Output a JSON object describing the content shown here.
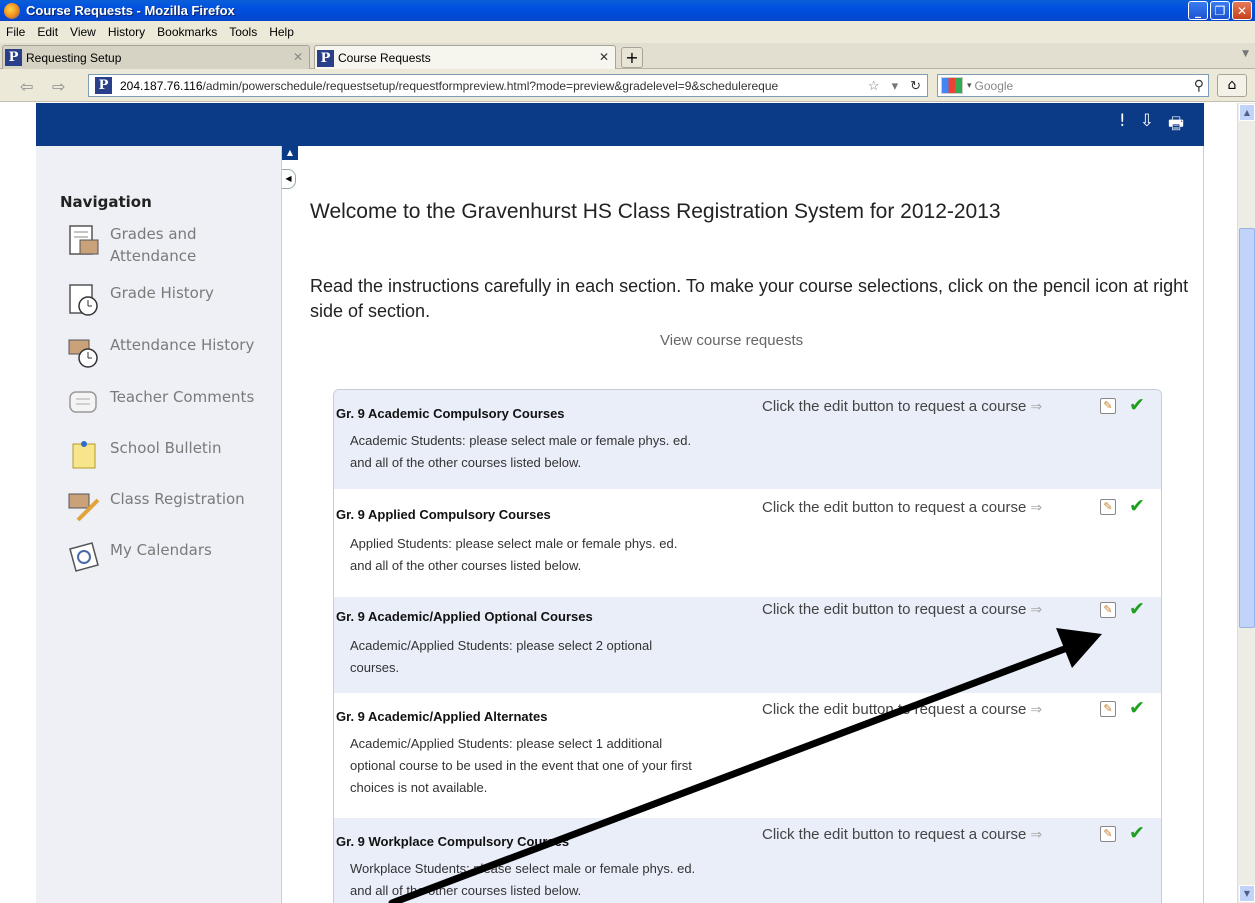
{
  "window": {
    "title": "Course Requests - Mozilla Firefox",
    "buttons": {
      "minimize": "_",
      "maximize": "❐",
      "close": "✕"
    }
  },
  "menu": [
    "File",
    "Edit",
    "View",
    "History",
    "Bookmarks",
    "Tools",
    "Help"
  ],
  "tabs": [
    {
      "label": "Requesting Setup",
      "active": false
    },
    {
      "label": "Course Requests",
      "active": true
    }
  ],
  "address": {
    "host": "204.187.76.116",
    "path": "/admin/powerschedule/requestsetup/requestformpreview.html?mode=preview&gradelevel=9&schedulereque",
    "favicon": "P"
  },
  "search": {
    "placeholder": "Google"
  },
  "page": {
    "header_icons": [
      "!",
      "⇩",
      "🖶"
    ],
    "nav_heading": "Navigation",
    "nav_items": [
      {
        "label": "Grades and Attendance",
        "icon": "grades-icon"
      },
      {
        "label": "Grade History",
        "icon": "grade-history-icon"
      },
      {
        "label": "Attendance History",
        "icon": "attendance-history-icon"
      },
      {
        "label": "Teacher Comments",
        "icon": "comments-icon"
      },
      {
        "label": "School Bulletin",
        "icon": "bulletin-icon"
      },
      {
        "label": "Class Registration",
        "icon": "registration-icon"
      },
      {
        "label": "My Calendars",
        "icon": "calendar-icon"
      }
    ],
    "welcome": "Welcome to the Gravenhurst HS Class Registration System for 2012-2013",
    "instructions": "Read the instructions carefully in each section. To make your course selections, click on the pencil icon at right side of section.",
    "view_link": "View course requests",
    "edit_prompt": "Click the edit button to request a course",
    "sections": [
      {
        "title": "Gr. 9 Academic Compulsory Courses",
        "desc": "Academic Students: please select male or female phys. ed. and all of the other courses listed below."
      },
      {
        "title": "Gr. 9 Applied Compulsory Courses",
        "desc": "Applied Students: please select male or female phys. ed. and all of the other courses listed below."
      },
      {
        "title": "Gr. 9 Academic/Applied Optional Courses",
        "desc": "Academic/Applied Students: please select 2 optional courses."
      },
      {
        "title": "Gr. 9 Academic/Applied Alternates",
        "desc": "Academic/Applied Students: please select 1 additional optional course to be used in the event that one of your first choices is not available."
      },
      {
        "title": "Gr. 9 Workplace Compulsory Courses",
        "desc": "Workplace Students: please select male or female phys. ed. and all of the other courses listed below."
      }
    ]
  },
  "colors": {
    "header_blue": "#0b3b86",
    "row_shade": "#eaeef9",
    "check_green": "#1fa01f"
  }
}
